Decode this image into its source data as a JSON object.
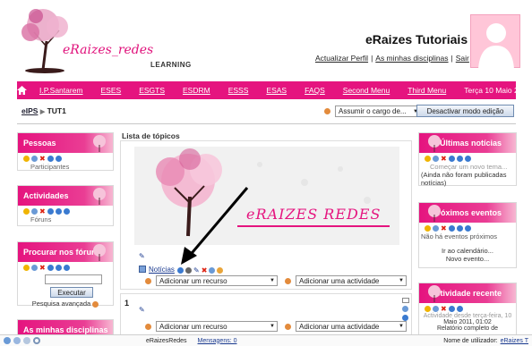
{
  "header": {
    "logo_text": "eRaizes_redes",
    "logo_sub": "LEARNING",
    "site_title": "eRaizes Tutoriais",
    "links": [
      "Actualizar Perfil",
      "As minhas disciplinas",
      "Sair"
    ]
  },
  "nav": {
    "items": [
      "I.P.Santarem",
      "ESES",
      "ESGTS",
      "ESDRM",
      "ESSS",
      "ESAS",
      "FAQS",
      "Second Menu",
      "Third Menu"
    ],
    "date": "Terça 10 Maio 2011"
  },
  "breadcrumb": {
    "root": "eIPS",
    "separator": "▶",
    "current": "TUT1"
  },
  "role_select": {
    "value": "Assumir o cargo de..."
  },
  "edit_button": "Desactivar modo edição",
  "left_blocks": {
    "pessoas": {
      "title": "Pessoas",
      "item": "Participantes"
    },
    "actividades": {
      "title": "Actividades",
      "item": "Fóruns"
    },
    "forums": {
      "title": "Procurar nos fóruns",
      "button": "Executar",
      "advanced": "Pesquisa avançada"
    },
    "disciplinas": {
      "title": "As minhas disciplinas"
    }
  },
  "main": {
    "title": "Lista de tópicos",
    "banner_text": "eRAIZES REDES",
    "noticias": "Notícias",
    "add_resource": "Adicionar um recurso",
    "add_activity": "Adicionar uma actividade",
    "section_number": "1"
  },
  "right_blocks": {
    "news": {
      "title": "Últimas notícias",
      "line1": "Começar um novo tema...",
      "line2": "(Ainda não foram publicadas notícias)"
    },
    "events": {
      "title": "Próximos eventos",
      "line1": "Não há eventos próximos",
      "line2": "Ir ao calendário...",
      "line3": "Novo evento..."
    },
    "recent": {
      "title": "Actividade recente",
      "line1": "Actividade desde terça-feira, 10",
      "line2": "Maio 2011, 01:02",
      "line3": "Relatório completo de"
    }
  },
  "statusbar": {
    "site": "eRaizesRedes",
    "messages": "Mensagens: 0",
    "user_label": "Nome de utilizador:",
    "user": "eRaizes T"
  },
  "colors": {
    "brand_pink": "#e5147f",
    "avatar_pink": "#ffc6d8"
  }
}
